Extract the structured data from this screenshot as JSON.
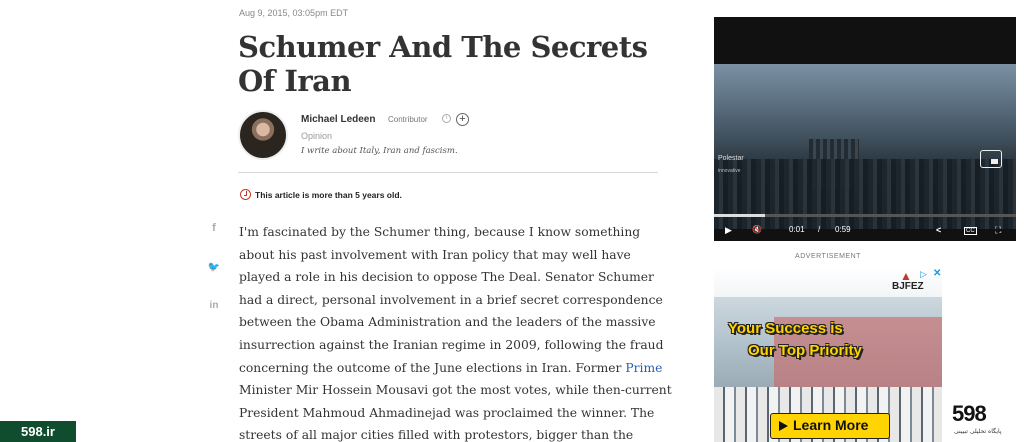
{
  "article": {
    "date": "Aug 9, 2015, 03:05pm EDT",
    "title": "Schumer And The Secrets Of Iran",
    "author": {
      "name": "Michael Ledeen",
      "role": "Contributor",
      "info_glyph": "i",
      "follow_glyph": "+",
      "category": "Opinion",
      "tagline": "I write about Italy, Iran and fascism."
    },
    "age_notice": "This article is more than 5 years old.",
    "body_lines": [
      "I'm fascinated by the Schumer thing, because I know something",
      "about his past involvement with Iran policy that may well have",
      "played a role in his decision to oppose The Deal. Senator Schumer",
      "had a direct, personal involvement in a brief secret correspondence",
      "between the Obama Administration and the leaders of the massive",
      "insurrection against the Iranian regime in 2009, following the fraud",
      "concerning the outcome of the June elections in Iran. Former"
    ],
    "body_line7_link": "Prime",
    "body_lines_after": [
      "Minister Mir Hossein Mousavi got the most votes, while then-current",
      "President Mahmoud Ahmadinejad was proclaimed the winner. The",
      "streets of all major cities filled with protestors, bigger than the"
    ]
  },
  "share": {
    "facebook": "f",
    "twitter": "🐦",
    "linkedin": "in"
  },
  "video": {
    "caption": "Polestar",
    "caption_sub": "innovative",
    "current_time": "0:01",
    "separator": "/",
    "duration": "0:59",
    "progress": 0.17,
    "play_glyph": "▶",
    "mute_glyph": "🔇",
    "share_glyph": "<",
    "cc_glyph": "CC",
    "fullscreen_glyph": "⛶"
  },
  "ad": {
    "label": "ADVERTISEMENT",
    "brand": "BJFEZ",
    "brand_mark": "▲",
    "choices_glyph": "▷",
    "close_glyph": "✕",
    "headline_line1": "Your Success is",
    "headline_line2": "Our Top Priority",
    "cta": "Learn More"
  },
  "watermarks": {
    "left": "598.ir",
    "right_mark": "598",
    "right_sub": "پایگاه تحلیلی تبیینی"
  },
  "colors": {
    "accent_red": "#c0392b",
    "link_blue": "#2a5db0",
    "ad_yellow": "#ffd400",
    "watermark_green": "#0f4d2e"
  }
}
